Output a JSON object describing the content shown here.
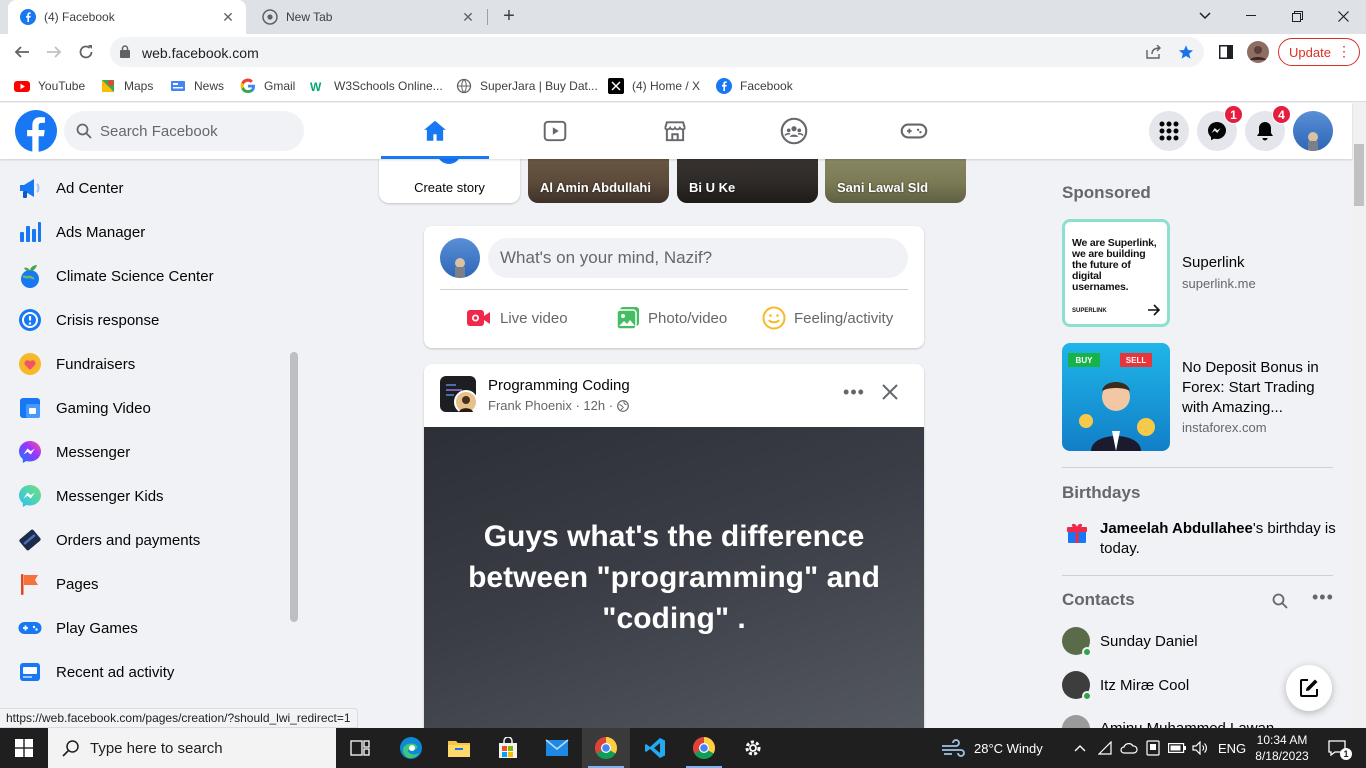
{
  "browser": {
    "tabs": [
      {
        "title": "(4) Facebook",
        "active": true
      },
      {
        "title": "New Tab",
        "active": false
      }
    ],
    "url": "web.facebook.com",
    "update_label": "Update",
    "bookmarks": [
      "YouTube",
      "Maps",
      "News",
      "Gmail",
      "W3Schools Online...",
      "SuperJara | Buy Dat...",
      "(4) Home / X",
      "Facebook"
    ],
    "status_url": "https://web.facebook.com/pages/creation/?should_lwi_redirect=1"
  },
  "header": {
    "search_placeholder": "Search Facebook",
    "messenger_badge": "1",
    "notifications_badge": "4",
    "brand_color": "#1877f2"
  },
  "left_sidebar": {
    "items": [
      {
        "label": "Ad Center",
        "icon": "megaphone-icon"
      },
      {
        "label": "Ads Manager",
        "icon": "bar-chart-icon"
      },
      {
        "label": "Climate Science Center",
        "icon": "globe-sprout-icon"
      },
      {
        "label": "Crisis response",
        "icon": "crisis-response-icon"
      },
      {
        "label": "Fundraisers",
        "icon": "heart-coin-icon"
      },
      {
        "label": "Gaming Video",
        "icon": "gaming-video-icon"
      },
      {
        "label": "Messenger",
        "icon": "messenger-icon"
      },
      {
        "label": "Messenger Kids",
        "icon": "messenger-kids-icon"
      },
      {
        "label": "Orders and payments",
        "icon": "payment-card-icon"
      },
      {
        "label": "Pages",
        "icon": "flag-icon"
      },
      {
        "label": "Play Games",
        "icon": "gamepad-icon"
      },
      {
        "label": "Recent ad activity",
        "icon": "ad-activity-icon"
      }
    ]
  },
  "stories": {
    "create_label": "Create story",
    "items": [
      "Al Amin Abdullahi",
      "Bi U Ke",
      "Sani Lawal Sld"
    ]
  },
  "composer": {
    "placeholder": "What's on your mind, Nazif?",
    "actions": [
      "Live video",
      "Photo/video",
      "Feeling/activity"
    ]
  },
  "post": {
    "group": "Programming Coding",
    "author": "Frank Phoenix",
    "time": "12h",
    "text": "Guys what's the difference between \"programming\" and \"coding\" ."
  },
  "right_sidebar": {
    "sponsored_heading": "Sponsored",
    "ads": [
      {
        "title": "Superlink",
        "domain": "superlink.me",
        "img_text": "We are Superlink, we are building the future of digital usernames.",
        "img_brand": "SUPERLINK"
      },
      {
        "title": "No Deposit Bonus in Forex: Start Trading with Amazing...",
        "domain": "instaforex.com",
        "img_buy": "BUY",
        "img_sell": "SELL"
      }
    ],
    "birthdays_heading": "Birthdays",
    "birthday_name": "Jameelah Abdullahee",
    "birthday_suffix": "'s birthday is today.",
    "contacts_heading": "Contacts",
    "contacts": [
      "Sunday Daniel",
      "Itz Miræ Cool",
      "Aminu Muhammed Lawan"
    ]
  },
  "taskbar": {
    "search_placeholder": "Type here to search",
    "weather": "28°C  Windy",
    "language": "ENG",
    "time": "10:34 AM",
    "date": "8/18/2023",
    "notification_count": "1"
  }
}
